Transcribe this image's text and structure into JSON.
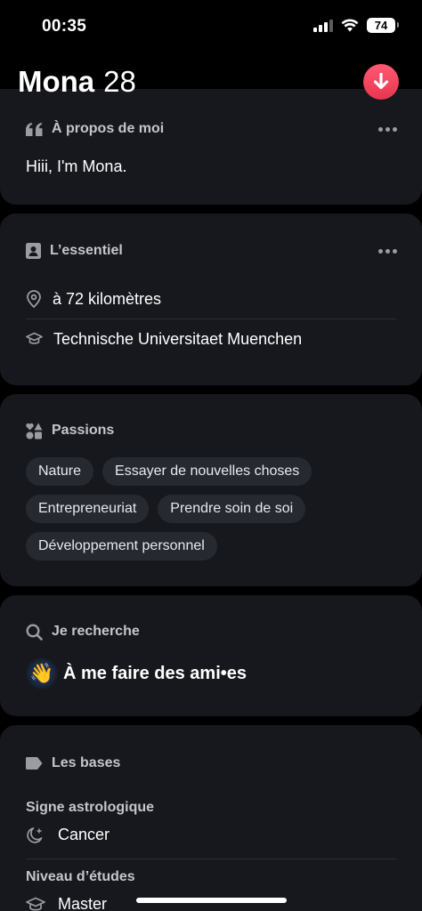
{
  "status_bar": {
    "time": "00:35",
    "battery": "74"
  },
  "profile": {
    "name": "Mona",
    "age": "28"
  },
  "about": {
    "title": "À propos de moi",
    "bio": "Hiii, I'm Mona."
  },
  "essentials": {
    "title": "L’essentiel",
    "distance": "à 72 kilomètres",
    "school": "Technische Universitaet Muenchen"
  },
  "passions": {
    "title": "Passions",
    "items": [
      "Nature",
      "Essayer de nouvelles choses",
      "Entrepreneuriat",
      "Prendre soin de soi",
      "Développement personnel"
    ]
  },
  "looking_for": {
    "title": "Je recherche",
    "emoji": "👋",
    "value": "À me faire des ami•es"
  },
  "basics": {
    "title": "Les bases",
    "zodiac_label": "Signe astrologique",
    "zodiac_value": "Cancer",
    "education_label": "Niveau d’études",
    "education_value": "Master"
  },
  "colors": {
    "card": "#16181d",
    "chip": "#262930",
    "accent": "#ff4a66"
  }
}
